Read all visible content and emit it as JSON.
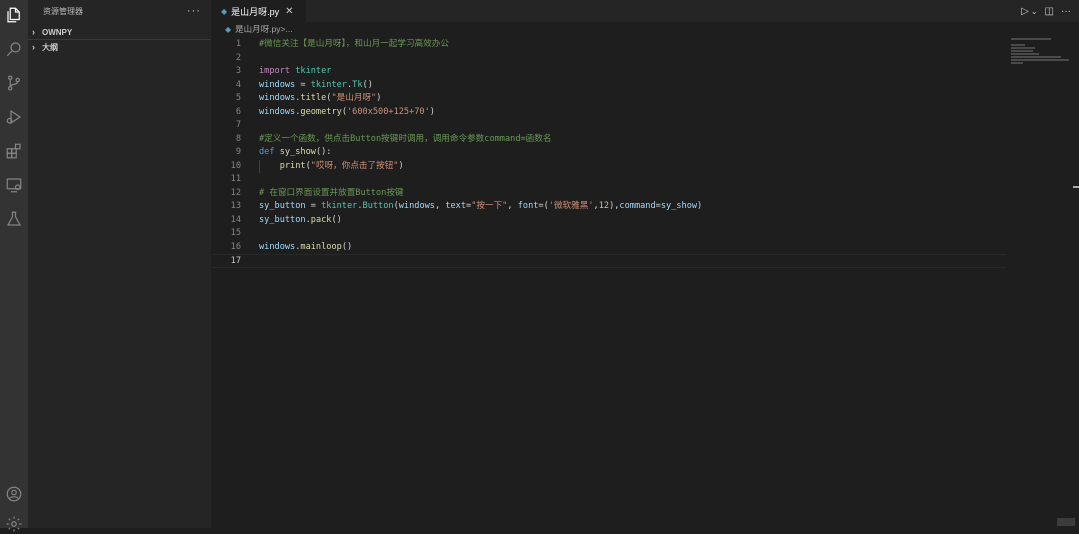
{
  "activity_bar": {
    "icons": [
      "files-icon",
      "search-icon",
      "source-control-icon",
      "run-debug-icon",
      "extensions-icon",
      "remote-explorer-icon",
      "testing-icon",
      "account-icon",
      "settings-gear-icon"
    ]
  },
  "sidebar": {
    "title": "资源管理器",
    "more": "···",
    "sections": [
      {
        "label": "OWNPY",
        "expanded": false
      },
      {
        "label": "大纲",
        "expanded": false
      }
    ]
  },
  "tab": {
    "filename": "是山月呀.py",
    "close": "✕"
  },
  "breadcrumb": {
    "file": "是山月呀.py",
    "sep": " > ",
    "more": "..."
  },
  "code_lines": [
    {
      "num": "1",
      "tokens": [
        {
          "t": "#微信关注【是山月呀】，和山月一起学习高效办公",
          "c": "c"
        }
      ]
    },
    {
      "num": "2",
      "tokens": []
    },
    {
      "num": "3",
      "tokens": [
        {
          "t": "import",
          "c": "kc"
        },
        {
          "t": " ",
          "c": "p"
        },
        {
          "t": "tkinter",
          "c": "m"
        }
      ]
    },
    {
      "num": "4",
      "tokens": [
        {
          "t": "windows",
          "c": "v"
        },
        {
          "t": " = ",
          "c": "p"
        },
        {
          "t": "tkinter",
          "c": "m"
        },
        {
          "t": ".",
          "c": "p"
        },
        {
          "t": "Tk",
          "c": "m"
        },
        {
          "t": "()",
          "c": "p"
        }
      ]
    },
    {
      "num": "5",
      "tokens": [
        {
          "t": "windows",
          "c": "v"
        },
        {
          "t": ".",
          "c": "p"
        },
        {
          "t": "title",
          "c": "f"
        },
        {
          "t": "(",
          "c": "p"
        },
        {
          "t": "\"是山月呀\"",
          "c": "s"
        },
        {
          "t": ")",
          "c": "p"
        }
      ]
    },
    {
      "num": "6",
      "tokens": [
        {
          "t": "windows",
          "c": "v"
        },
        {
          "t": ".",
          "c": "p"
        },
        {
          "t": "geometry",
          "c": "f"
        },
        {
          "t": "(",
          "c": "p"
        },
        {
          "t": "'600x500+125+70'",
          "c": "s"
        },
        {
          "t": ")",
          "c": "p"
        }
      ]
    },
    {
      "num": "7",
      "tokens": []
    },
    {
      "num": "8",
      "tokens": [
        {
          "t": "#定义一个函数，供点击Button按键时调用，调用命令参数command=函数名",
          "c": "c"
        }
      ]
    },
    {
      "num": "9",
      "tokens": [
        {
          "t": "def",
          "c": "k"
        },
        {
          "t": " ",
          "c": "p"
        },
        {
          "t": "sy_show",
          "c": "f"
        },
        {
          "t": "():",
          "c": "p"
        }
      ]
    },
    {
      "num": "10",
      "tokens": [
        {
          "t": "    ",
          "c": "p"
        },
        {
          "t": "print",
          "c": "f"
        },
        {
          "t": "(",
          "c": "p"
        },
        {
          "t": "\"哎呀，你点击了按钮\"",
          "c": "s"
        },
        {
          "t": ")",
          "c": "p"
        }
      ],
      "guide": true
    },
    {
      "num": "11",
      "tokens": []
    },
    {
      "num": "12",
      "tokens": [
        {
          "t": "# 在窗口界面设置并放置Button按键",
          "c": "c"
        }
      ]
    },
    {
      "num": "13",
      "tokens": [
        {
          "t": "sy_button",
          "c": "v"
        },
        {
          "t": " = ",
          "c": "p"
        },
        {
          "t": "tkinter",
          "c": "m"
        },
        {
          "t": ".",
          "c": "p"
        },
        {
          "t": "Button",
          "c": "m"
        },
        {
          "t": "(",
          "c": "p"
        },
        {
          "t": "windows",
          "c": "v"
        },
        {
          "t": ", ",
          "c": "p"
        },
        {
          "t": "text",
          "c": "v"
        },
        {
          "t": "=",
          "c": "p"
        },
        {
          "t": "\"按一下\"",
          "c": "s"
        },
        {
          "t": ", ",
          "c": "p"
        },
        {
          "t": "font",
          "c": "v"
        },
        {
          "t": "=(",
          "c": "p"
        },
        {
          "t": "'微软雅黑'",
          "c": "s"
        },
        {
          "t": ",",
          "c": "p"
        },
        {
          "t": "12",
          "c": "n"
        },
        {
          "t": "),",
          "c": "p"
        },
        {
          "t": "command",
          "c": "v"
        },
        {
          "t": "=",
          "c": "p"
        },
        {
          "t": "sy_show",
          "c": "v"
        },
        {
          "t": ")",
          "c": "p"
        }
      ]
    },
    {
      "num": "14",
      "tokens": [
        {
          "t": "sy_button",
          "c": "v"
        },
        {
          "t": ".",
          "c": "p"
        },
        {
          "t": "pack",
          "c": "f"
        },
        {
          "t": "()",
          "c": "p"
        }
      ]
    },
    {
      "num": "15",
      "tokens": []
    },
    {
      "num": "16",
      "tokens": [
        {
          "t": "windows",
          "c": "v"
        },
        {
          "t": ".",
          "c": "p"
        },
        {
          "t": "mainloop",
          "c": "f"
        },
        {
          "t": "()",
          "c": "p"
        }
      ]
    },
    {
      "num": "17",
      "tokens": [],
      "active": true
    }
  ],
  "editor_actions": {
    "run": "▷",
    "run_dropdown": "⌄",
    "split": "◫",
    "more": "···"
  },
  "colors": {
    "accent": "#519aba",
    "comment": "#6a9955",
    "string": "#ce9178",
    "keyword": "#569cd6"
  }
}
